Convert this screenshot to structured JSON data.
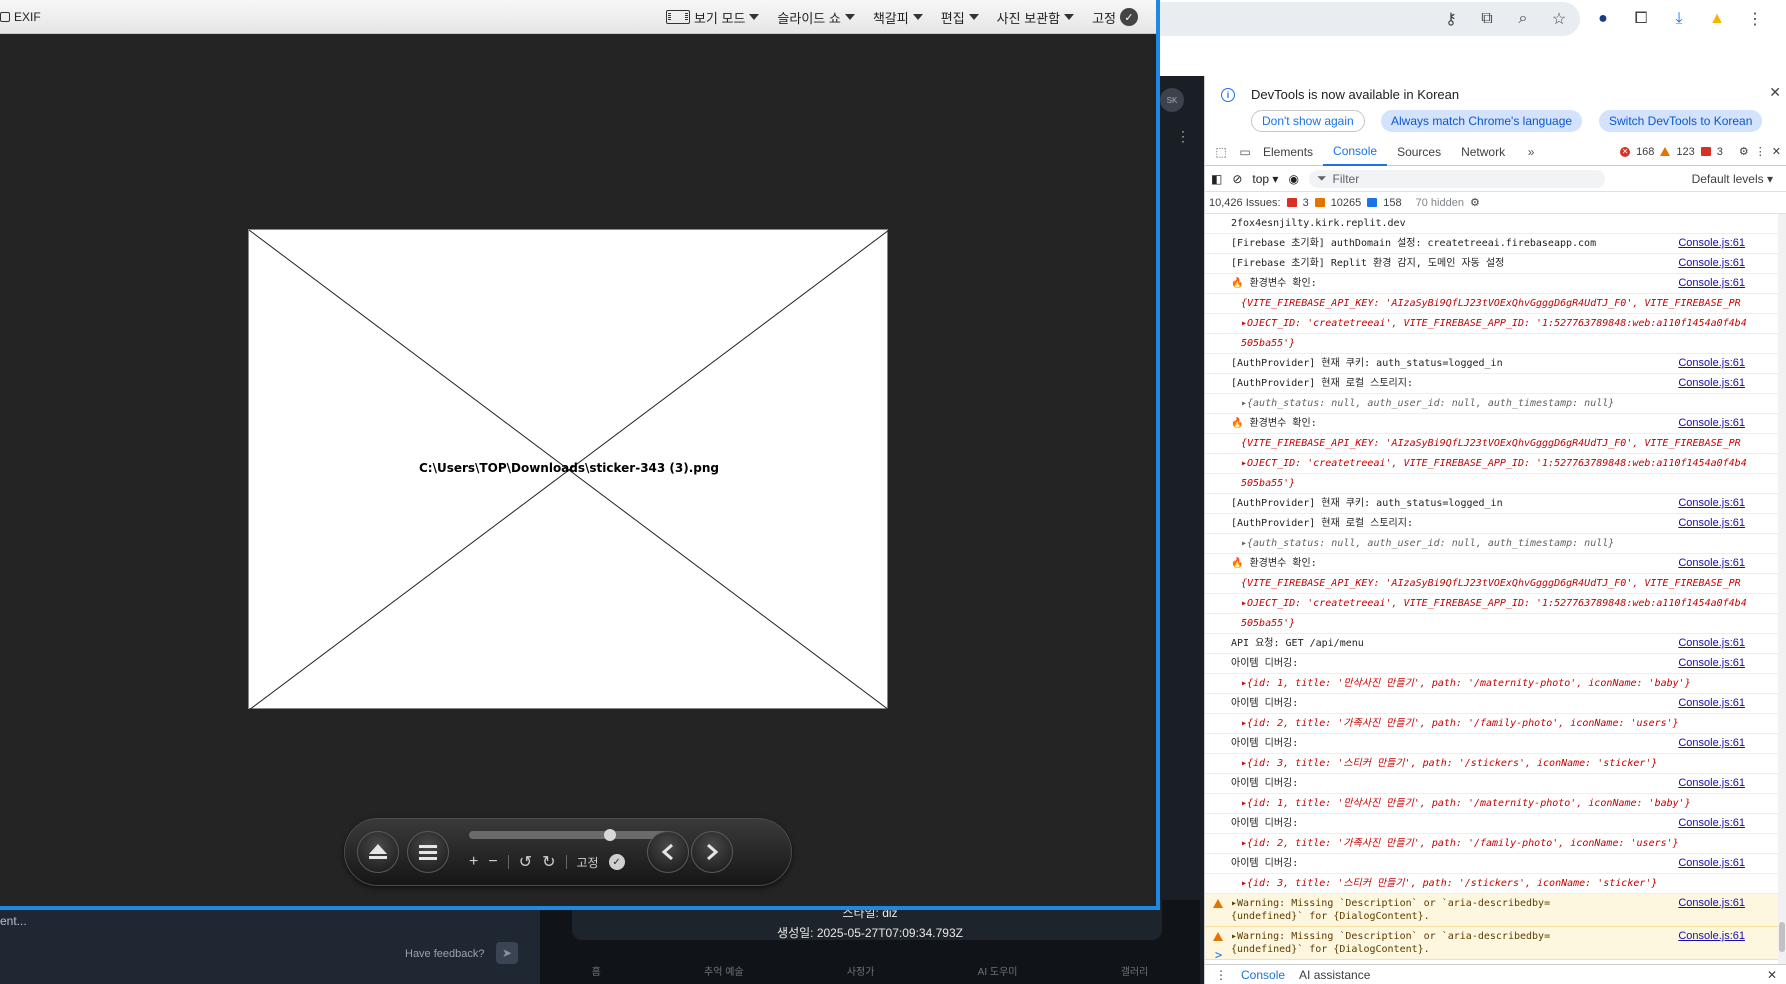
{
  "viewer": {
    "exif_label": "EXIF",
    "menus": [
      {
        "label": "보기 모드"
      },
      {
        "label": "슬라이드 쇼"
      },
      {
        "label": "책갈피"
      },
      {
        "label": "편집"
      },
      {
        "label": "사진 보관함"
      }
    ],
    "pin_label": "고정",
    "broken_image_path": "C:\\Users\\TOP\\Downloads\\sticker-343 (3).png",
    "controls": {
      "zoom_in": "+",
      "zoom_out": "−",
      "pin_label": "고정",
      "slider_value": 0.72
    }
  },
  "background_app": {
    "style_text": "스타일: diz",
    "created_text": "생성일: 2025-05-27T07:09:34.793Z",
    "nav": [
      "홈",
      "추억 예술",
      "사정가",
      "AI 도우미",
      "갤러리"
    ],
    "feedback_label": "Have feedback?",
    "input_text": "ent...",
    "avatar_text": "SK"
  },
  "devtools": {
    "info_message": "DevTools is now available in Korean",
    "btn_dont_show": "Don't show again",
    "btn_match": "Always match Chrome's language",
    "btn_switch": "Switch DevTools to Korean",
    "tabs": [
      "Elements",
      "Console",
      "Sources",
      "Network"
    ],
    "active_tab": "Console",
    "error_count": "168",
    "warning_count": "123",
    "issue_count_tab": "3",
    "context": "top",
    "filter_placeholder": "Filter",
    "levels": "Default levels",
    "issues_label": "10,426 Issues:",
    "issues_red": "3",
    "issues_orange": "10265",
    "issues_blue": "158",
    "hidden_label": "70 hidden",
    "source": "Console.js:61",
    "logs": [
      {
        "text": "2fox4esnjilty.kirk.replit.dev",
        "src": false
      },
      {
        "text": "[Firebase 초기화] authDomain 설정: createtreeai.firebaseapp.com",
        "src": true
      },
      {
        "text": "[Firebase 초기화] Replit 환경 감지, 도메인 자동 설정",
        "src": true
      },
      {
        "text": "🔥 환경변수 확인:",
        "src": true,
        "kind": "env"
      },
      {
        "text": "{VITE_FIREBASE_API_KEY: 'AIzaSyBi9QfLJ23tVOExQhvGgggD6gR4UdTJ_F0', VITE_FIREBASE_PR",
        "src": false,
        "kind": "objred"
      },
      {
        "text": "▸OJECT_ID: 'createtreeai', VITE_FIREBASE_APP_ID: '1:527763789848:web:a110f1454a0f4b4",
        "src": false,
        "kind": "objred"
      },
      {
        "text": "505ba55'}",
        "src": false,
        "kind": "objred"
      },
      {
        "text": "[AuthProvider] 현재 쿠키: auth_status=logged_in",
        "src": true
      },
      {
        "text": "[AuthProvider] 현재 로컬 스토리지:",
        "src": true
      },
      {
        "text": "▸{auth_status: null, auth_user_id: null, auth_timestamp: null}",
        "src": false,
        "kind": "obj"
      },
      {
        "text": "🔥 환경변수 확인:",
        "src": true,
        "kind": "env"
      },
      {
        "text": "{VITE_FIREBASE_API_KEY: 'AIzaSyBi9QfLJ23tVOExQhvGgggD6gR4UdTJ_F0', VITE_FIREBASE_PR",
        "src": false,
        "kind": "objred"
      },
      {
        "text": "▸OJECT_ID: 'createtreeai', VITE_FIREBASE_APP_ID: '1:527763789848:web:a110f1454a0f4b4",
        "src": false,
        "kind": "objred"
      },
      {
        "text": "505ba55'}",
        "src": false,
        "kind": "objred"
      },
      {
        "text": "[AuthProvider] 현재 쿠키: auth_status=logged_in",
        "src": true
      },
      {
        "text": "[AuthProvider] 현재 로컬 스토리지:",
        "src": true
      },
      {
        "text": "▸{auth_status: null, auth_user_id: null, auth_timestamp: null}",
        "src": false,
        "kind": "obj"
      },
      {
        "text": "🔥 환경변수 확인:",
        "src": true,
        "kind": "env"
      },
      {
        "text": "{VITE_FIREBASE_API_KEY: 'AIzaSyBi9QfLJ23tVOExQhvGgggD6gR4UdTJ_F0', VITE_FIREBASE_PR",
        "src": false,
        "kind": "objred"
      },
      {
        "text": "▸OJECT_ID: 'createtreeai', VITE_FIREBASE_APP_ID: '1:527763789848:web:a110f1454a0f4b4",
        "src": false,
        "kind": "objred"
      },
      {
        "text": "505ba55'}",
        "src": false,
        "kind": "objred"
      },
      {
        "text": "API 요청: GET /api/menu",
        "src": true
      },
      {
        "text": "아이템 디버깅:",
        "src": true
      },
      {
        "text": "▸{id: 1, title: '만삭사진 만들기', path: '/maternity-photo', iconName: 'baby'}",
        "src": false,
        "kind": "objred"
      },
      {
        "text": "아이템 디버깅:",
        "src": true
      },
      {
        "text": "▸{id: 2, title: '가족사진 만들기', path: '/family-photo', iconName: 'users'}",
        "src": false,
        "kind": "objred"
      },
      {
        "text": "아이템 디버깅:",
        "src": true
      },
      {
        "text": "▸{id: 3, title: '스티커 만들기', path: '/stickers', iconName: 'sticker'}",
        "src": false,
        "kind": "objred"
      },
      {
        "text": "아이템 디버깅:",
        "src": true
      },
      {
        "text": "▸{id: 1, title: '만삭사진 만들기', path: '/maternity-photo', iconName: 'baby'}",
        "src": false,
        "kind": "objred"
      },
      {
        "text": "아이템 디버깅:",
        "src": true
      },
      {
        "text": "▸{id: 2, title: '가족사진 만들기', path: '/family-photo', iconName: 'users'}",
        "src": false,
        "kind": "objred"
      },
      {
        "text": "아이템 디버깅:",
        "src": true
      },
      {
        "text": "▸{id: 3, title: '스티커 만들기', path: '/stickers', iconName: 'sticker'}",
        "src": false,
        "kind": "objred"
      }
    ],
    "warnings": [
      "▸Warning: Missing `Description` or `aria-describedby={undefined}` for {DialogContent}.",
      "▸Warning: Missing `Description` or `aria-describedby={undefined}` for {DialogContent}."
    ],
    "prompt": ">",
    "drawer_console": "Console",
    "drawer_ai": "AI assistance"
  },
  "colors": {
    "viewer_border": "#1e88e5",
    "viewer_bg": "#242424",
    "devtools_accent": "#1a73e8",
    "error": "#d93025",
    "warning": "#e37400"
  }
}
